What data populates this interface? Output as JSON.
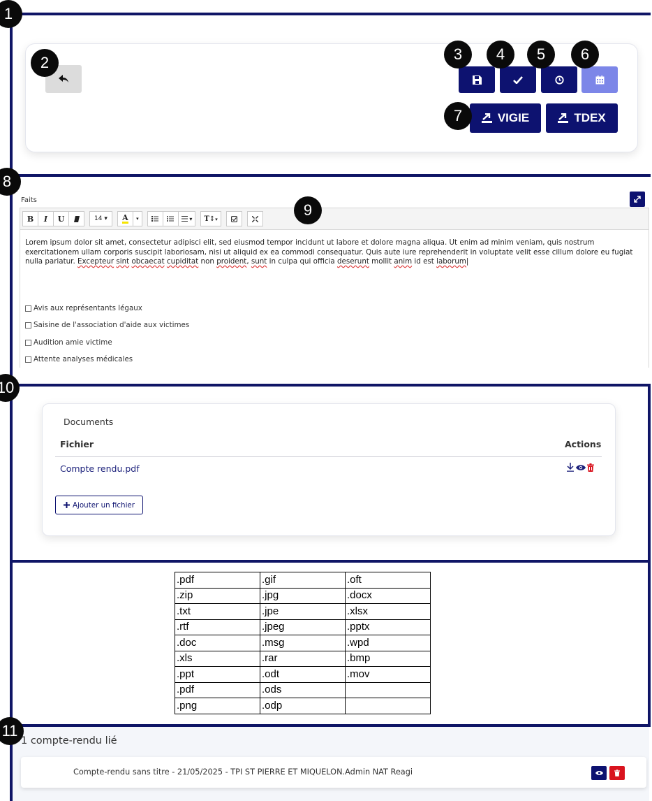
{
  "markers": [
    "1",
    "2",
    "3",
    "4",
    "5",
    "6",
    "7",
    "8",
    "9",
    "10",
    "11"
  ],
  "toolbar": {
    "back_icon": "reply-arrow-icon",
    "save_icon": "save-icon",
    "validate_icon": "check-icon",
    "history_icon": "clock-icon",
    "calendar_icon": "calendar-icon",
    "vigie_label": "VIGIE",
    "tdex_label": "TDEX",
    "colors": {
      "primary": "#0d1270",
      "light": "#7c86e8",
      "back": "#dcdcdc"
    }
  },
  "editor": {
    "label": "Faits",
    "font_size": "14",
    "buttons": [
      "B",
      "I",
      "U",
      "eraser",
      "14",
      "A",
      "▾",
      "ul",
      "ol",
      "align",
      "T↕",
      "check",
      "fullscreen"
    ],
    "paragraph_1": "Lorem ipsum dolor sit amet, consectetur adipisci elit, sed eiusmod tempor incidunt ut labore et dolore magna aliqua. Ut enim ad minim veniam, quis nostrum",
    "paragraph_2": "exercitationem ullam corporis suscipit laboriosam, nisi ut aliquid ex ea commodi consequatur. Quis aute iure reprehenderit in voluptate velit esse cillum dolore eu fugiat",
    "paragraph_3a": "nulla pariatur. ",
    "paragraph_3_spell": [
      "Excepteur",
      "sint",
      "obcaecat",
      "cupiditat"
    ],
    "paragraph_3b": " non ",
    "paragraph_3_spell2": "proident",
    "paragraph_3c": ", ",
    "paragraph_3_spell3": "sunt",
    "paragraph_3d": " in culpa qui officia ",
    "paragraph_3_spell4": "deserunt",
    "paragraph_3e": " mollit ",
    "paragraph_3_spell5": "anim",
    "paragraph_3f": " id est ",
    "paragraph_3_spell6": "laborum",
    "checkboxes": [
      "Avis aux représentants légaux",
      "Saisine de l'association d'aide aux victimes",
      "Audition amie victime",
      "Attente analyses médicales"
    ]
  },
  "documents": {
    "title": "Documents",
    "col_file": "Fichier",
    "col_actions": "Actions",
    "file_name": "Compte rendu.pdf",
    "add_button": "Ajouter un fichier"
  },
  "extensions": [
    [
      ".pdf",
      ".gif",
      ".oft"
    ],
    [
      ".zip",
      ".jpg",
      ".docx"
    ],
    [
      ".txt",
      ".jpe",
      ".xlsx"
    ],
    [
      ".rtf",
      ".jpeg",
      ".pptx"
    ],
    [
      ".doc",
      ".msg",
      ".wpd"
    ],
    [
      ".xls",
      ".rar",
      ".bmp"
    ],
    [
      ".ppt",
      ".odt",
      ".mov"
    ],
    [
      ".pdf",
      ".ods",
      ""
    ],
    [
      ".png",
      ".odp",
      ""
    ]
  ],
  "linked": {
    "heading": "1 compte-rendu lié",
    "item": "Compte-rendu sans titre - 21/05/2025 - TPI ST PIERRE ET MIQUELON.Admin NAT Reagi"
  }
}
